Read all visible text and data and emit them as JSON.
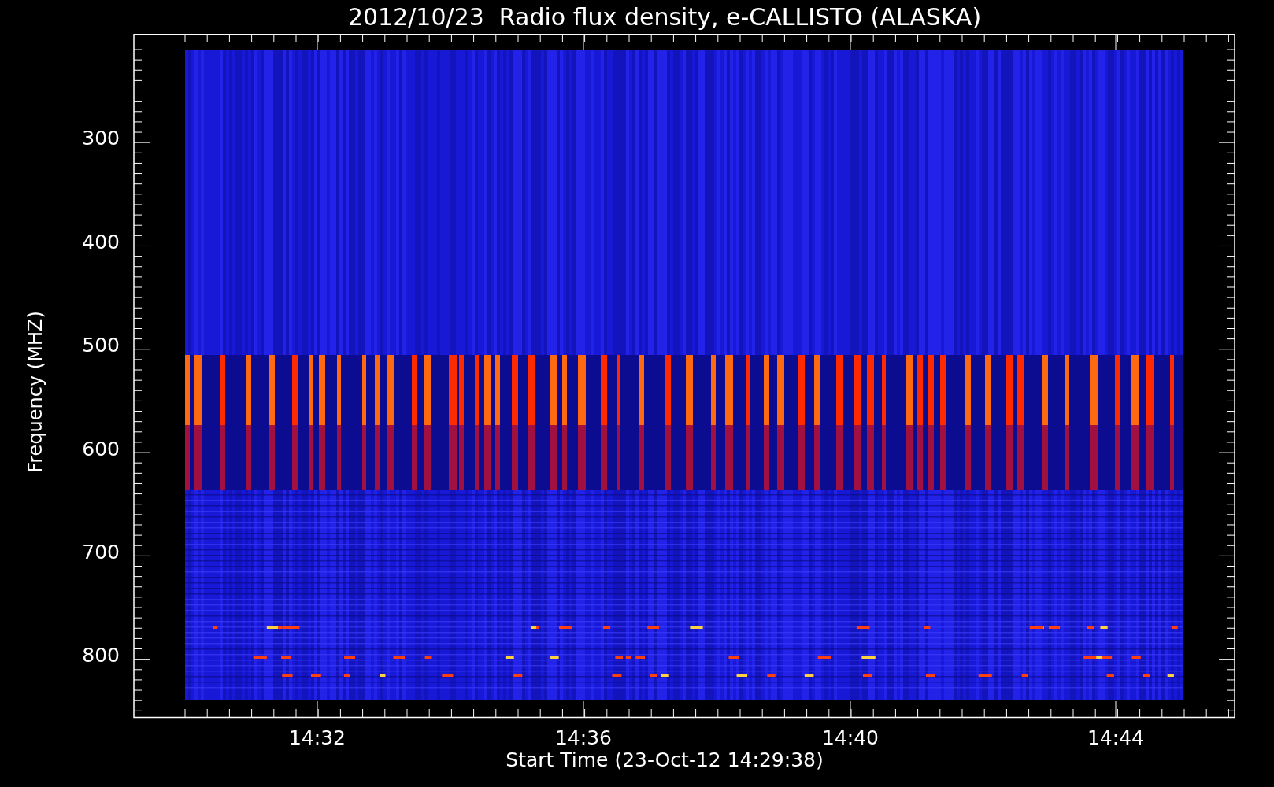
{
  "chart": {
    "title": "2012/10/23  Radio flux density, e-CALLISTO (ALASKA)",
    "ylabel": "Frequency (MHZ)",
    "xlabel": "Start Time (23-Oct-12 14:29:38)",
    "yticks": [
      "300",
      "400",
      "500",
      "600",
      "700",
      "800"
    ],
    "xticks": [
      "14:32",
      "14:36",
      "14:40",
      "14:44"
    ]
  }
}
